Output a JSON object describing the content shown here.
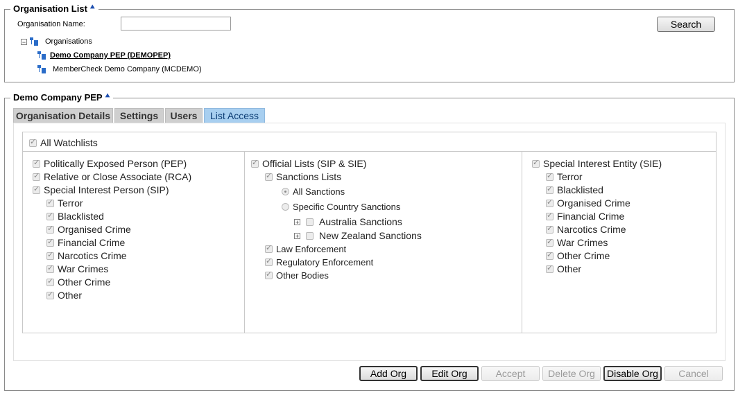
{
  "org_list": {
    "title": "Organisation List",
    "name_label": "Organisation Name:",
    "name_value": "",
    "search_label": "Search",
    "tree": {
      "root": "Organisations",
      "children": [
        "Demo Company PEP (DEMOPEP)",
        "MemberCheck Demo Company (MCDEMO)"
      ]
    }
  },
  "org_detail": {
    "title": "Demo Company PEP",
    "tabs": [
      "Organisation Details",
      "Settings",
      "Users",
      "List Access"
    ],
    "active_tab": "List Access"
  },
  "list_access": {
    "all_watchlists": "All Watchlists",
    "col1": {
      "items": [
        "Politically Exposed Person (PEP)",
        "Relative or Close Associate (RCA)",
        "Special Interest Person (SIP)"
      ],
      "sip_children": [
        "Terror",
        "Blacklisted",
        "Organised Crime",
        "Financial Crime",
        "Narcotics Crime",
        "War Crimes",
        "Other Crime",
        "Other"
      ]
    },
    "col2": {
      "official": "Official Lists (SIP & SIE)",
      "sanctions": "Sanctions Lists",
      "all_sanctions": "All Sanctions",
      "specific_country": "Specific Country Sanctions",
      "countries": [
        "Australia Sanctions",
        "New Zealand Sanctions"
      ],
      "others": [
        "Law Enforcement",
        "Regulatory Enforcement",
        "Other Bodies"
      ]
    },
    "col3": {
      "sie": "Special Interest Entity (SIE)",
      "sie_children": [
        "Terror",
        "Blacklisted",
        "Organised Crime",
        "Financial Crime",
        "Narcotics Crime",
        "War Crimes",
        "Other Crime",
        "Other"
      ]
    }
  },
  "actions": {
    "add": "Add Org",
    "edit": "Edit Org",
    "accept": "Accept",
    "delete": "Delete Org",
    "disable": "Disable Org",
    "cancel": "Cancel"
  }
}
